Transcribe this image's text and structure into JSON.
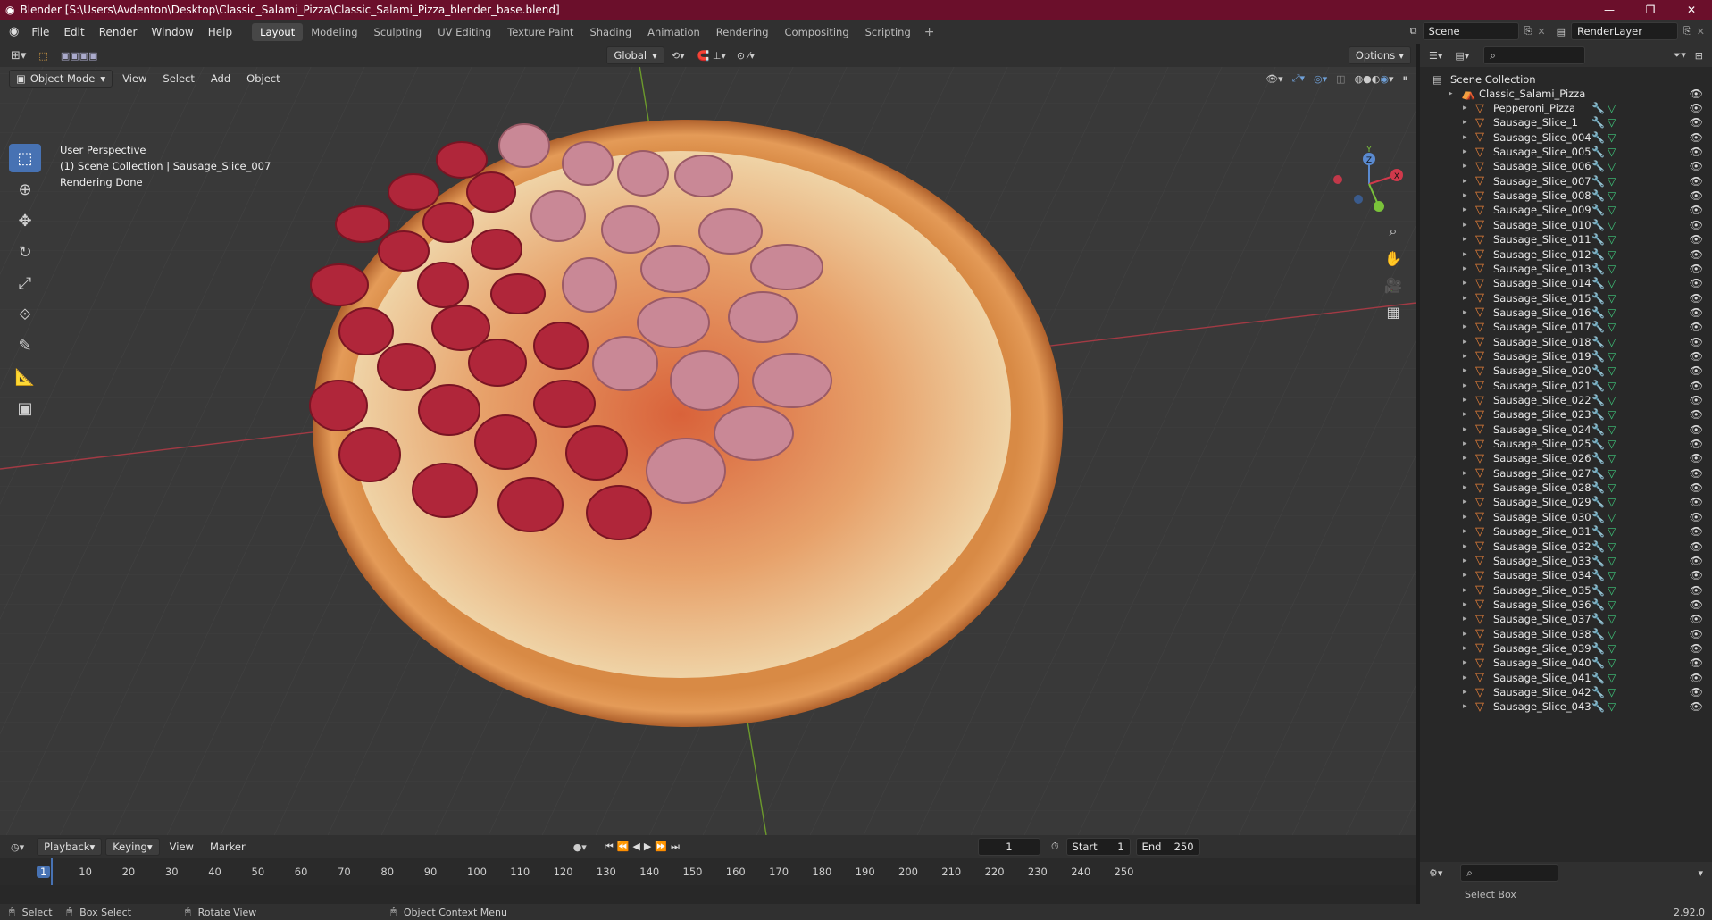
{
  "window": {
    "title": "Blender [S:\\Users\\Avdenton\\Desktop\\Classic_Salami_Pizza\\Classic_Salami_Pizza_blender_base.blend]"
  },
  "menu": [
    "File",
    "Edit",
    "Render",
    "Window",
    "Help"
  ],
  "workspaces": [
    "Layout",
    "Modeling",
    "Sculpting",
    "UV Editing",
    "Texture Paint",
    "Shading",
    "Animation",
    "Rendering",
    "Compositing",
    "Scripting"
  ],
  "active_workspace": "Layout",
  "scene": {
    "name": "Scene",
    "view_layer": "RenderLayer"
  },
  "viewport": {
    "mode": "Object Mode",
    "menus": [
      "View",
      "Select",
      "Add",
      "Object"
    ],
    "orientation": "Global",
    "options_label": "Options",
    "info": [
      "User Perspective",
      "(1) Scene Collection | Sausage_Slice_007",
      "Rendering Done"
    ],
    "gizmo": {
      "x": "X",
      "y": "Y",
      "z": "Z"
    }
  },
  "outliner": {
    "root": "Scene Collection",
    "collection": "Classic_Salami_Pizza",
    "items": [
      "Pepperoni_Pizza",
      "Sausage_Slice_1",
      "Sausage_Slice_004",
      "Sausage_Slice_005",
      "Sausage_Slice_006",
      "Sausage_Slice_007",
      "Sausage_Slice_008",
      "Sausage_Slice_009",
      "Sausage_Slice_010",
      "Sausage_Slice_011",
      "Sausage_Slice_012",
      "Sausage_Slice_013",
      "Sausage_Slice_014",
      "Sausage_Slice_015",
      "Sausage_Slice_016",
      "Sausage_Slice_017",
      "Sausage_Slice_018",
      "Sausage_Slice_019",
      "Sausage_Slice_020",
      "Sausage_Slice_021",
      "Sausage_Slice_022",
      "Sausage_Slice_023",
      "Sausage_Slice_024",
      "Sausage_Slice_025",
      "Sausage_Slice_026",
      "Sausage_Slice_027",
      "Sausage_Slice_028",
      "Sausage_Slice_029",
      "Sausage_Slice_030",
      "Sausage_Slice_031",
      "Sausage_Slice_032",
      "Sausage_Slice_033",
      "Sausage_Slice_034",
      "Sausage_Slice_035",
      "Sausage_Slice_036",
      "Sausage_Slice_037",
      "Sausage_Slice_038",
      "Sausage_Slice_039",
      "Sausage_Slice_040",
      "Sausage_Slice_041",
      "Sausage_Slice_042",
      "Sausage_Slice_043"
    ]
  },
  "timeline": {
    "menus": [
      "Playback",
      "Keying",
      "View",
      "Marker"
    ],
    "current_frame": "1",
    "start_label": "Start",
    "start": "1",
    "end_label": "End",
    "end": "250",
    "ruler": [
      "1",
      "10",
      "20",
      "30",
      "40",
      "50",
      "60",
      "70",
      "80",
      "90",
      "100",
      "110",
      "120",
      "130",
      "140",
      "150",
      "160",
      "170",
      "180",
      "190",
      "200",
      "210",
      "220",
      "230",
      "240",
      "250"
    ]
  },
  "statusbar": {
    "select": "Select",
    "box_select": "Box Select",
    "rotate": "Rotate View",
    "context": "Object Context Menu",
    "version": "2.92.0"
  },
  "props_partial": "Select Box",
  "colors": {
    "title_bar": "#6b0f2b",
    "accent": "#4772b3",
    "mesh_icon": "#e8813a",
    "modifier_icon": "#6fa0d8",
    "data_icon": "#3fc97c",
    "x_axis": "#e0394b",
    "y_axis": "#7ac23a"
  }
}
